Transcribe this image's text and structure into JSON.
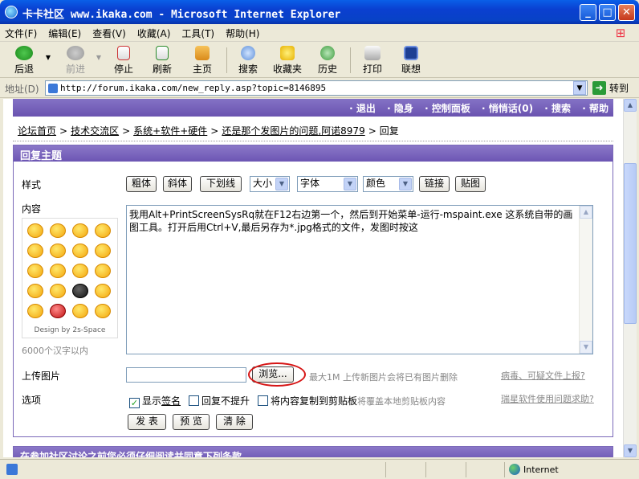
{
  "window": {
    "title": "卡卡社区 www.ikaka.com - Microsoft Internet Explorer",
    "minimize": "_",
    "maximize": "□",
    "close": "✕"
  },
  "menu": [
    "文件(F)",
    "编辑(E)",
    "查看(V)",
    "收藏(A)",
    "工具(T)",
    "帮助(H)"
  ],
  "toolbar": {
    "back": "后退",
    "forward": "前进",
    "stop": "停止",
    "refresh": "刷新",
    "home": "主页",
    "search": "搜索",
    "favorites": "收藏夹",
    "history": "历史",
    "print": "打印",
    "lenovo": "联想"
  },
  "address": {
    "label": "地址(D)",
    "url": "http://forum.ikaka.com/new_reply.asp?topic=8146895",
    "go": "转到"
  },
  "topnav": [
    "退出",
    "隐身",
    "控制面板",
    "悄悄话(0)",
    "搜索",
    "帮助"
  ],
  "breadcrumb": [
    "论坛首页",
    "技术交流区",
    "系统+软件+硬件",
    "还是那个发图片的问题,阿诺8979",
    "回复"
  ],
  "panel": {
    "title": "回复主题",
    "style_label": "样式",
    "format_buttons": [
      "粗体",
      "斜体",
      "下划线"
    ],
    "size_select": "大小",
    "font_select": "字体",
    "color_select": "颜色",
    "link_button": "链接",
    "image_button": "贴图",
    "content_label": "内容",
    "content_text": "我用Alt+PrintScreenSysRq就在F12右边第一个，然后到开始菜单-运行-mspaint.exe 这系统自带的画图工具。打开后用Ctrl+V,最后另存为*.jpg格式的文件，发图时按这",
    "smiley_caption": "Design by 2s-Space",
    "char_limit": "6000个汉字以内",
    "upload_label": "上传图片",
    "browse_button": "浏览...",
    "upload_hint": "最大1M 上传新图片会将已有图片删除",
    "virus_link": "病毒、可疑文件上报?",
    "options_label": "选项",
    "opt_signature_prefix": "显示",
    "opt_signature_link": "签名",
    "opt_no_bump": "回复不提升",
    "opt_copy_clipboard": "将内容复制到剪贴板",
    "opt_copy_hint": "将覆盖本地剪贴板内容",
    "rising_link": "瑞星软件使用问题求助?",
    "submit_button": "发 表",
    "preview_button": "预 览",
    "clear_button": "清 除"
  },
  "panel2_title": "在参加社区讨论之前您必须仔细阅读并同意下列条款",
  "status": {
    "zone": "Internet"
  }
}
